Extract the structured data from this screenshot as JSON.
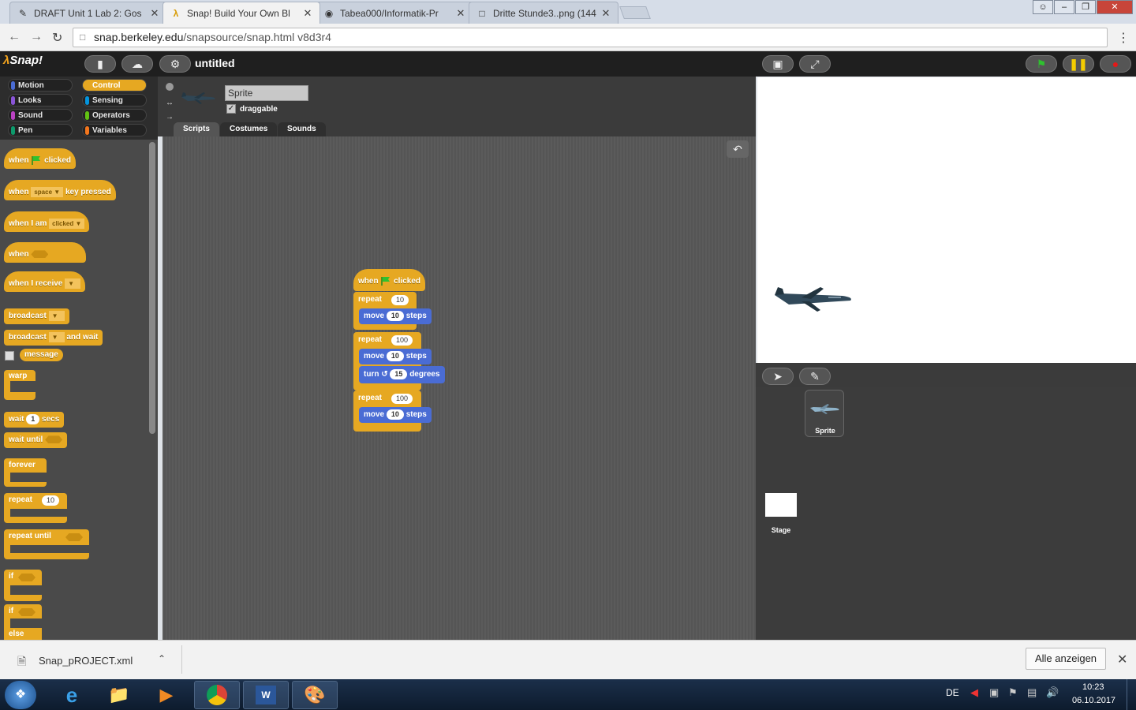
{
  "browser": {
    "tabs": [
      {
        "title": "DRAFT Unit 1 Lab 2: Gos",
        "icon": "page-icon"
      },
      {
        "title": "Snap! Build Your Own Bl",
        "icon": "lambda-icon"
      },
      {
        "title": "Tabea000/Informatik-Pr",
        "icon": "github-icon"
      },
      {
        "title": "Dritte Stunde3..png (144",
        "icon": "page-icon"
      }
    ],
    "url_host": "snap.berkeley.edu",
    "url_path": "/snapsource/snap.html  v8d3r4"
  },
  "snap": {
    "logo": "Snap!",
    "project_title": "untitled",
    "categories": [
      "Motion",
      "Looks",
      "Sound",
      "Pen",
      "Control",
      "Sensing",
      "Operators",
      "Variables"
    ],
    "category_colors": [
      "#4a6cd4",
      "#8a55d7",
      "#bb42c3",
      "#0e9a6c",
      "#e6a822",
      "#0494dc",
      "#62c213",
      "#f3761d"
    ],
    "selected_category": "Control",
    "palette": {
      "when": "when",
      "clicked": "clicked",
      "key_pressed": "key pressed",
      "space": "space",
      "when_i_am": "when I am",
      "clicked_opt": "clicked",
      "when_i_receive": "when I receive",
      "broadcast": "broadcast",
      "and_wait": "and wait",
      "message": "message",
      "warp": "warp",
      "wait": "wait",
      "secs": "secs",
      "wait_secs_val": "1",
      "wait_until": "wait until",
      "forever": "forever",
      "repeat": "repeat",
      "repeat_val": "10",
      "repeat_until": "repeat until",
      "if": "if",
      "else": "else"
    },
    "sprite_name": "Sprite",
    "draggable_label": "draggable",
    "tabs": [
      "Scripts",
      "Costumes",
      "Sounds"
    ],
    "script": {
      "when": "when",
      "clicked": "clicked",
      "repeat": "repeat",
      "move": "move",
      "steps": "steps",
      "turn": "turn",
      "degrees": "degrees",
      "r1": "10",
      "m1": "10",
      "r2": "100",
      "m2": "10",
      "t1": "15",
      "r3": "100",
      "m3": "10"
    },
    "corral_sprite": "Sprite",
    "corral_stage": "Stage"
  },
  "download": {
    "file": "Snap_pROJECT.xml",
    "show_all": "Alle anzeigen"
  },
  "taskbar": {
    "lang": "DE",
    "time": "10:23",
    "date": "06.10.2017"
  }
}
